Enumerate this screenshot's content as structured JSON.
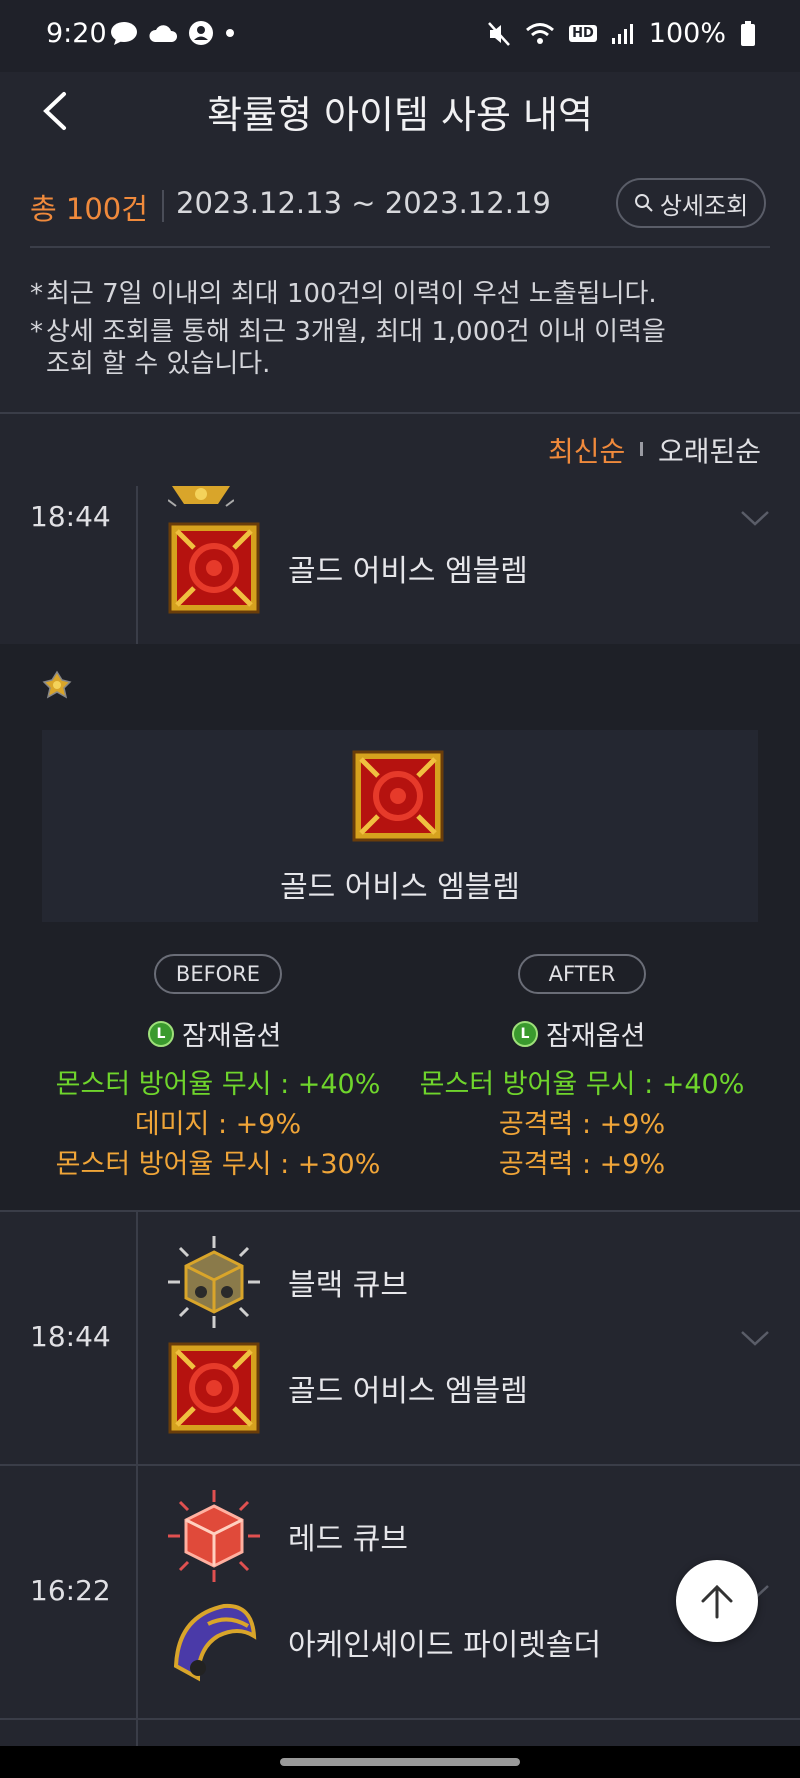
{
  "status_bar": {
    "time": "9:20",
    "battery": "100%",
    "hd_voice": "HD"
  },
  "header": {
    "title": "확률형 아이템 사용 내역"
  },
  "summary": {
    "total": "총 100건",
    "date_range": "2023.12.13 ~ 2023.12.19",
    "search_label": "상세조회"
  },
  "notes": [
    "최근 7일 이내의 최대 100건의 이력이 우선 노출됩니다.",
    "상세 조회를 통해 최근 3개월, 최대 1,000건 이내 이력을",
    "조회 할 수 있습니다."
  ],
  "sort": {
    "newest": "최신순",
    "oldest": "오래된순"
  },
  "records": [
    {
      "time": "18:44",
      "items": [
        "골드 어비스 엠블렘"
      ]
    },
    {
      "time": "18:44",
      "items": [
        "블랙 큐브",
        "골드 어비스 엠블렘"
      ]
    },
    {
      "time": "16:22",
      "items": [
        "레드 큐브",
        "아케인셰이드 파이렛숄더"
      ]
    }
  ],
  "detail": {
    "item_name": "골드 어비스 엠블렘",
    "before_label": "BEFORE",
    "after_label": "AFTER",
    "potential_label": "잠재옵션",
    "grade_badge": "L",
    "before_options": [
      {
        "text": "몬스터 방어율 무시 : +40%",
        "color": "green"
      },
      {
        "text": "데미지 : +9%",
        "color": "orange"
      },
      {
        "text": "몬스터 방어율 무시 : +30%",
        "color": "orange"
      }
    ],
    "after_options": [
      {
        "text": "몬스터 방어율 무시 : +40%",
        "color": "green"
      },
      {
        "text": "공격력 : +9%",
        "color": "orange"
      },
      {
        "text": "공격력 : +9%",
        "color": "orange"
      }
    ]
  },
  "colors": {
    "accent": "#f08a3c",
    "green_option": "#6fd52c",
    "orange_option": "#f0a538",
    "background": "#24262f"
  }
}
